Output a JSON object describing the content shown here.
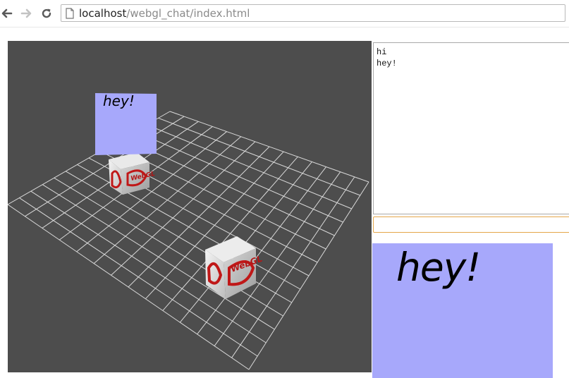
{
  "browser": {
    "url_host": "localhost",
    "url_path": "/webgl_chat/index.html",
    "icons": [
      "back-arrow-icon",
      "forward-arrow-icon",
      "reload-icon",
      "page-icon"
    ]
  },
  "scene": {
    "background": "#4d4d4d",
    "grid_color": "#d9d9d9",
    "bubble_color": "#a7a8fb",
    "bubble_text": "hey!",
    "cube_logo_text": "WebGL"
  },
  "chat": {
    "messages": [
      {
        "text": "hi"
      },
      {
        "text": "hey!"
      }
    ],
    "input_value": "",
    "input_border_color": "#e5a64a"
  },
  "preview": {
    "text": "hey!",
    "background": "#a7a8fb"
  }
}
